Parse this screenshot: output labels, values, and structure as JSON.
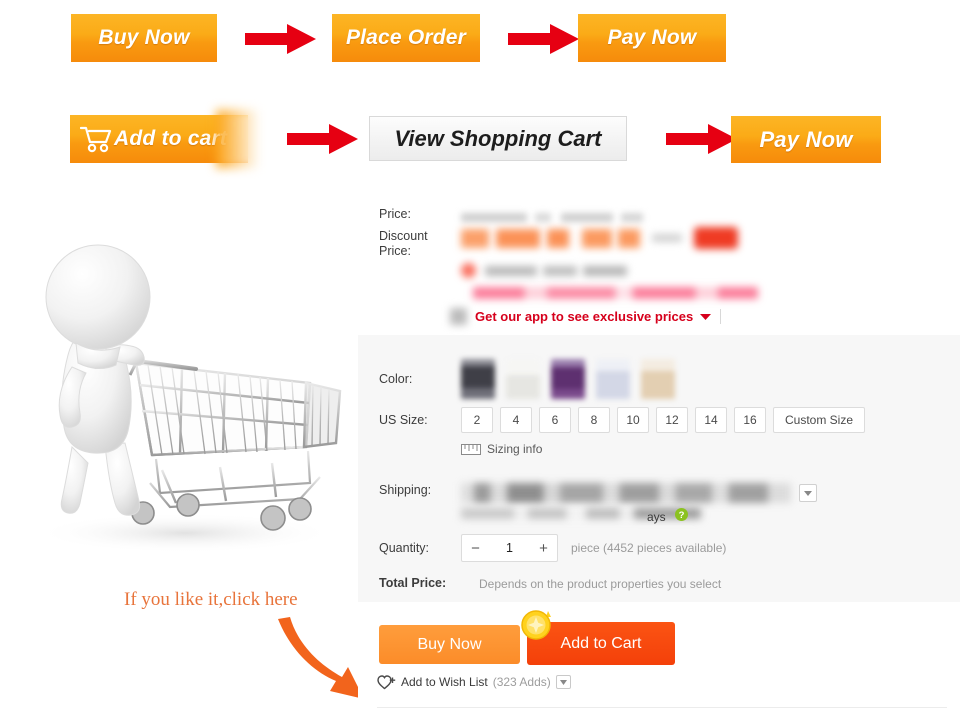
{
  "flow_row_1": {
    "steps": [
      {
        "label": "Buy Now",
        "type": "orange"
      },
      {
        "label": "Place Order",
        "type": "orange"
      },
      {
        "label": "Pay Now",
        "type": "orange"
      }
    ],
    "arrow_icon": "right-arrow-icon",
    "arrow_color": "#e60012"
  },
  "flow_row_2": {
    "steps": [
      {
        "label": "Add to cart",
        "type": "orange",
        "icon": "shopping-cart-icon"
      },
      {
        "label": "View Shopping Cart",
        "type": "ghost"
      },
      {
        "label": "Pay Now",
        "type": "orange"
      }
    ],
    "arrow_icon": "right-arrow-icon",
    "arrow_color": "#e60012"
  },
  "illustration": {
    "name": "3d-mannequin-pushing-shopping-cart",
    "alt": "white 3D figure pushing a chrome shopping cart"
  },
  "hint": {
    "text": "If you like it,click here",
    "color": "#e8743b",
    "arrow_icon": "curved-down-right-arrow-icon",
    "arrow_color": "#f2641c"
  },
  "product": {
    "price": {
      "label": "Price:",
      "value_redacted": true
    },
    "discount_price": {
      "label": "Discount Price:",
      "value_redacted": true,
      "badge_color": "#ef3b24"
    },
    "app_promo": {
      "text": "Get our app to see exclusive prices",
      "color": "#d6001c",
      "caret_icon": "chevron-down-icon"
    },
    "color": {
      "label": "Color:",
      "swatches": [
        {
          "name": "black",
          "hex": "#4a4a50"
        },
        {
          "name": "ivory-white",
          "hex": "#efefec"
        },
        {
          "name": "purple",
          "hex": "#5e3070"
        },
        {
          "name": "light-lavender",
          "hex": "#d8dbe8"
        },
        {
          "name": "beige",
          "hex": "#e6d4bc"
        }
      ]
    },
    "us_size": {
      "label": "US Size:",
      "options": [
        "2",
        "4",
        "6",
        "8",
        "10",
        "12",
        "14",
        "16"
      ],
      "custom_option": "Custom Size",
      "sizing_info_label": "Sizing info",
      "sizing_info_icon": "ruler-icon"
    },
    "shipping": {
      "label": "Shipping:",
      "value_redacted": true,
      "estimate_suffix": "ays",
      "caret_icon": "chevron-down-icon",
      "help_icon": "question-mark-icon",
      "help_color": "#8bc220"
    },
    "quantity": {
      "label": "Quantity:",
      "value": "1",
      "minus_icon": "minus-icon",
      "plus_icon": "plus-icon",
      "availability": "piece (4452 pieces available)"
    },
    "total_price": {
      "label": "Total Price:",
      "value": "Depends on the product properties you select"
    },
    "actions": {
      "buy_now": "Buy Now",
      "add_to_cart": "Add to Cart",
      "coin_icon": "gold-coin-icon",
      "wish_list": "Add to Wish List",
      "wish_list_count": "(323 Adds)",
      "wish_icon": "heart-plus-icon",
      "wish_caret_icon": "chevron-down-icon"
    }
  }
}
